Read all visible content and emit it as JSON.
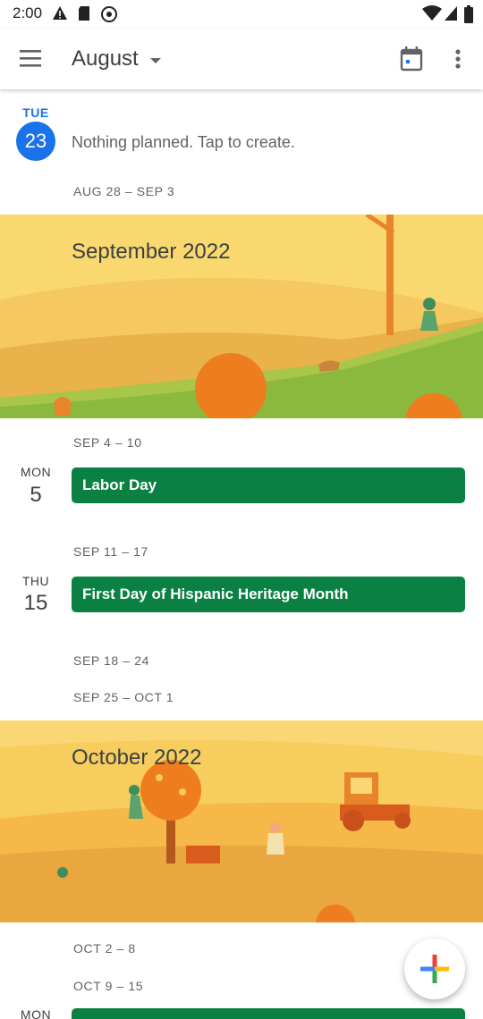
{
  "status_bar": {
    "time": "2:00",
    "icons": [
      "alert-icon",
      "sd-card-icon",
      "sync-icon",
      "wifi-icon",
      "signal-icon",
      "battery-icon"
    ]
  },
  "app_bar": {
    "menu_icon": "hamburger-menu-icon",
    "month": "August",
    "dropdown_icon": "caret-down-icon",
    "today_icon": "calendar-today-icon",
    "overflow_icon": "more-vert-icon"
  },
  "schedule": {
    "today": {
      "dow": "TUE",
      "day": "23",
      "text": "Nothing planned. Tap to create."
    },
    "week_aug28": "AUG 28 – SEP 3",
    "september_banner": "September 2022",
    "week_sep4": "SEP 4 – 10",
    "labor_day": {
      "dow": "MON",
      "day": "5",
      "title": "Labor Day"
    },
    "week_sep11": "SEP 11 – 17",
    "hispanic": {
      "dow": "THU",
      "day": "15",
      "title": "First Day of Hispanic Heritage Month"
    },
    "week_sep18": "SEP 18 – 24",
    "week_sep25": "SEP 25 – OCT 1",
    "october_banner": "October 2022",
    "week_oct2": "OCT 2 – 8",
    "week_oct9": "OCT 9 – 15",
    "partial": {
      "dow": "MON"
    }
  },
  "fab": {
    "icon": "add-icon"
  },
  "colors": {
    "accent": "#1a73e8",
    "event_green": "#0b8043",
    "text": "#3c4043",
    "secondary_text": "#5f6368"
  }
}
